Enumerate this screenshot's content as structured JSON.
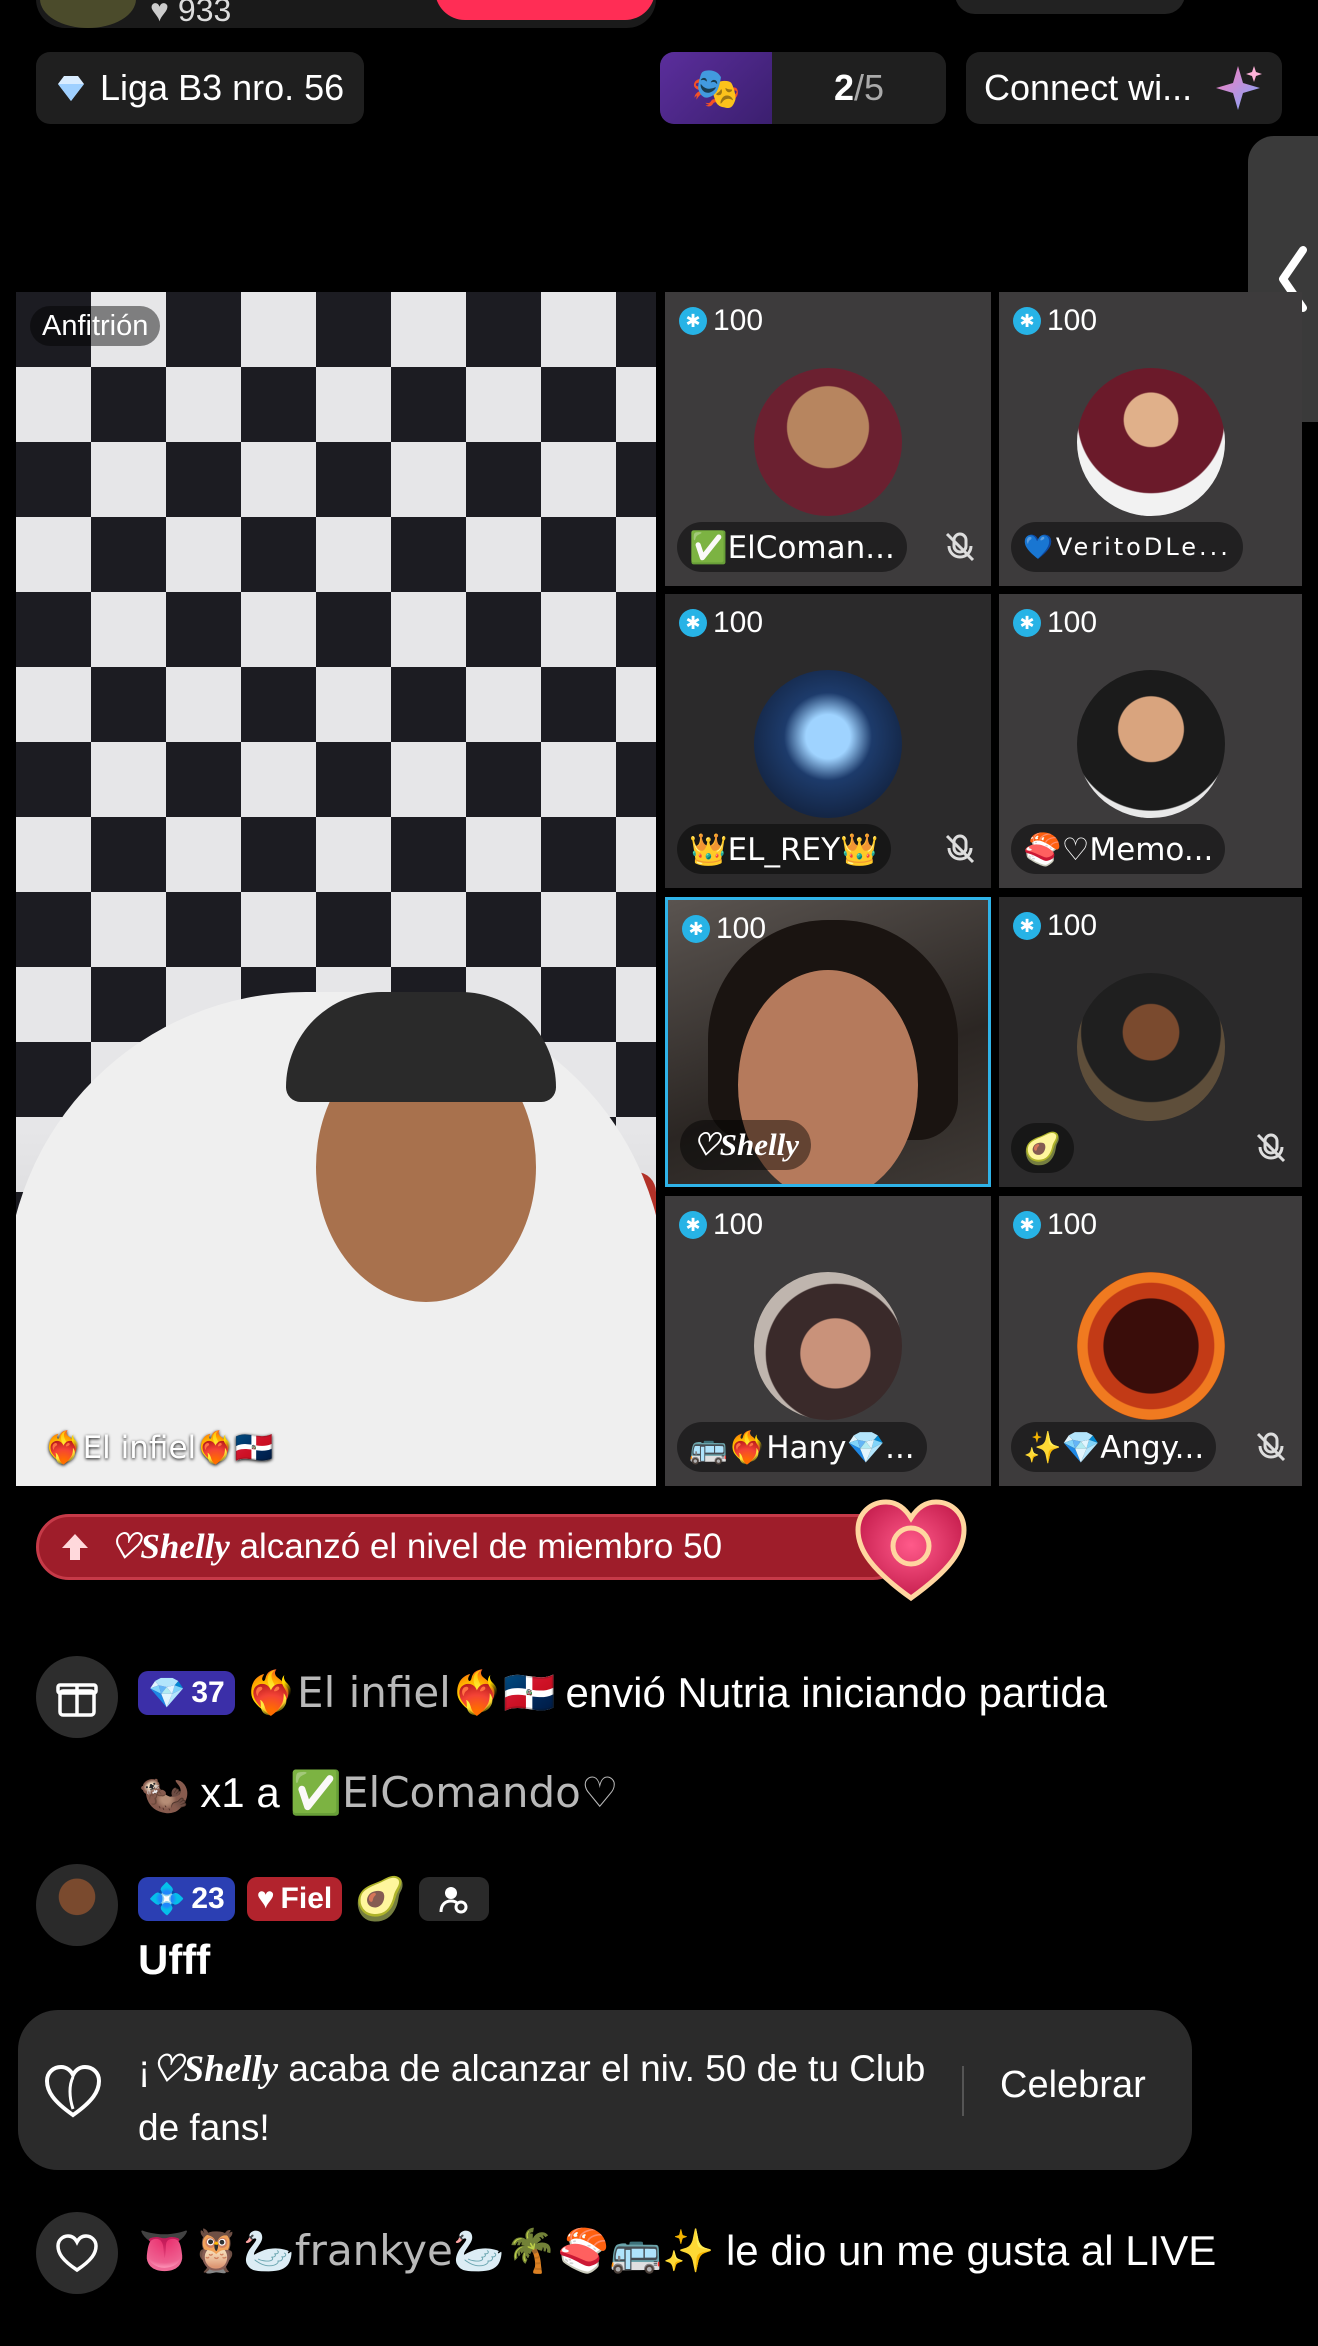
{
  "top": {
    "viewer_count": "933",
    "league_label": "Liga B3 nro. 56",
    "match_progress": "2",
    "match_total": "/5",
    "connect_label": "Connect wi..."
  },
  "host": {
    "tag": "Anfitrión",
    "name": "❤️‍🔥El infiel❤️‍🔥🇩🇴"
  },
  "guests": [
    {
      "score": "100",
      "name": "✅ElComan...",
      "muted": true
    },
    {
      "score": "100",
      "name": "💙VeritoDLe...",
      "muted": false
    },
    {
      "score": "100",
      "name": "👑EL_REY👑",
      "muted": true
    },
    {
      "score": "100",
      "name": "🍣♡Memo...",
      "muted": false
    },
    {
      "score": "100",
      "name": "♡Shelly",
      "muted": false
    },
    {
      "score": "100",
      "name": "🥑",
      "muted": true
    },
    {
      "score": "100",
      "name": "🚌❤️‍🔥Hany💎...",
      "muted": false
    },
    {
      "score": "100",
      "name": "✨💎Angy...",
      "muted": true
    }
  ],
  "banner": {
    "name": "♡Shelly",
    "text": " alcanzó el nivel de miembro 50"
  },
  "chat": {
    "gift": {
      "level": "37",
      "sender": "❤️‍🔥El infiel❤️‍🔥🇩🇴",
      "action": "envió Nutria iniciando partida",
      "qty": "x1 a",
      "recipient": "✅ElComando♡"
    },
    "comment": {
      "level": "23",
      "fan_badge": "Fiel",
      "text": "Ufff"
    },
    "card": {
      "prefix": "¡",
      "name": "♡Shelly",
      "text": " acaba de alcanzar el niv. 50 de tu Club de fans!",
      "action": "Celebrar"
    },
    "like": {
      "user": "👅🦉🦢frankye🦢🌴🍣🚌✨",
      "text": "le dio un me gusta al LIVE"
    }
  },
  "colors": {
    "accent_blue": "#2fb3e8",
    "banner_red": "#9e1d2a",
    "live_pink": "#ff2d55"
  }
}
